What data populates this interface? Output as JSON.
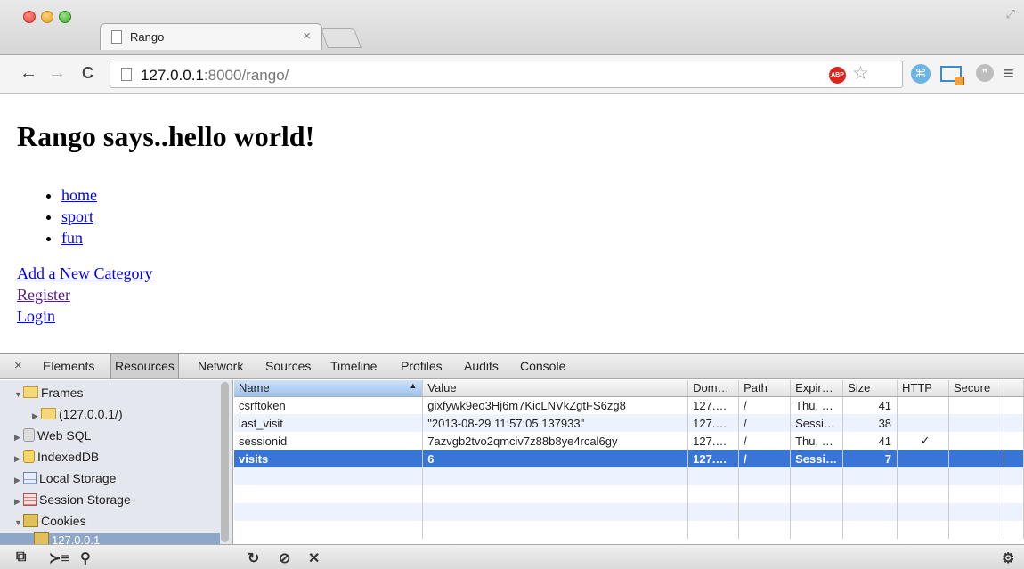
{
  "browser": {
    "tab_title": "Rango",
    "tab_close": "×",
    "url_host": "127.0.0.1",
    "url_rest": ":8000/rango/",
    "abp_label": "ABP",
    "icons": [
      "back-icon",
      "forward-icon",
      "reload-icon",
      "page-icon",
      "adblock-icon",
      "bookmark-star-icon",
      "extension-icon",
      "screenshot-extension-icon",
      "chat-extension-icon",
      "menu-icon",
      "fullscreen-icon"
    ]
  },
  "page": {
    "heading": "Rango says..hello world!",
    "categories": [
      "home",
      "sport",
      "fun"
    ],
    "links": [
      "Add a New Category",
      "Register",
      "Login"
    ]
  },
  "devtools": {
    "close_label": "×",
    "tabs": [
      "Elements",
      "Resources",
      "Network",
      "Sources",
      "Timeline",
      "Profiles",
      "Audits",
      "Console"
    ],
    "selected_tab": "Resources",
    "sidebar": [
      {
        "label": "Frames",
        "expanded": true
      },
      {
        "label": "(127.0.0.1/)",
        "expanded": false
      },
      {
        "label": "Web SQL",
        "expanded": false
      },
      {
        "label": "IndexedDB",
        "expanded": false
      },
      {
        "label": "Local Storage",
        "expanded": false
      },
      {
        "label": "Session Storage",
        "expanded": false
      },
      {
        "label": "Cookies",
        "expanded": true
      },
      {
        "label": "127.0.0.1",
        "selected": true
      }
    ],
    "columns": [
      "Name",
      "Value",
      "Dom…",
      "Path",
      "Expir…",
      "Size",
      "HTTP",
      "Secure"
    ],
    "rows": [
      {
        "name": "csrftoken",
        "value": "gixfywk9eo3Hj6m7KicLNVkZgtFS6zg8",
        "domain": "127.…",
        "path": "/",
        "expires": "Thu, …",
        "size": "41",
        "http": "",
        "secure": ""
      },
      {
        "name": "last_visit",
        "value": "\"2013-08-29 11:57:05.137933\"",
        "domain": "127.…",
        "path": "/",
        "expires": "Sessi…",
        "size": "38",
        "http": "",
        "secure": ""
      },
      {
        "name": "sessionid",
        "value": "7azvgb2tvo2qmciv7z88b8ye4rcal6gy",
        "domain": "127.…",
        "path": "/",
        "expires": "Thu, …",
        "size": "41",
        "http": "✓",
        "secure": ""
      },
      {
        "name": "visits",
        "value": "6",
        "domain": "127.…",
        "path": "/",
        "expires": "Sessi…",
        "size": "7",
        "http": "",
        "secure": "",
        "selected": true
      }
    ],
    "statusbar_icons": [
      "dock-icon",
      "console-drawer-icon",
      "search-icon",
      "refresh-icon",
      "clear-icon",
      "delete-icon",
      "settings-icon"
    ]
  }
}
